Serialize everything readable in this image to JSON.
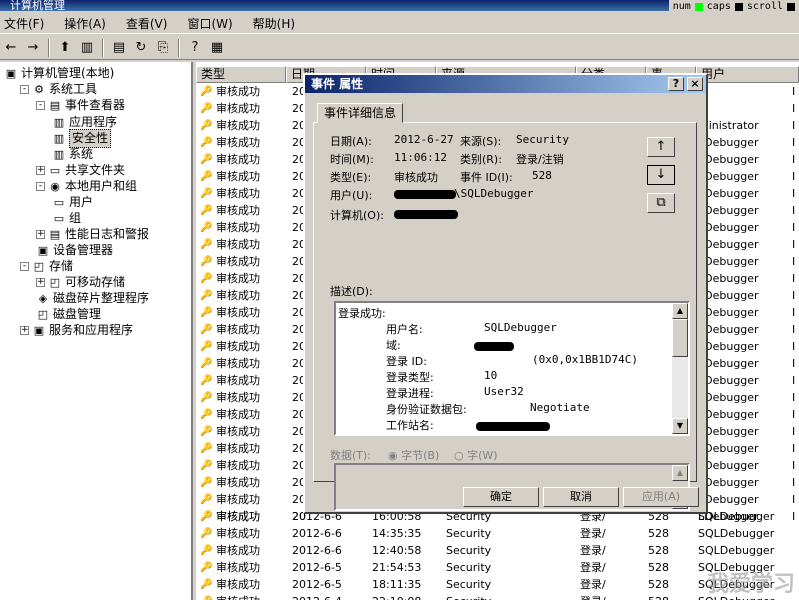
{
  "window_title": "计算机管理",
  "tray": {
    "num": "num",
    "caps": "caps",
    "scroll": "scroll"
  },
  "menu": [
    "文件(F)",
    "操作(A)",
    "查看(V)",
    "窗口(W)",
    "帮助(H)"
  ],
  "tree": [
    {
      "label": "计算机管理(本地)",
      "depth": 0,
      "pm": ""
    },
    {
      "label": "系统工具",
      "depth": 1,
      "pm": "-"
    },
    {
      "label": "事件查看器",
      "depth": 2,
      "pm": "-"
    },
    {
      "label": "应用程序",
      "depth": 3,
      "pm": ""
    },
    {
      "label": "安全性",
      "depth": 3,
      "pm": "",
      "selected": true
    },
    {
      "label": "系统",
      "depth": 3,
      "pm": ""
    },
    {
      "label": "共享文件夹",
      "depth": 2,
      "pm": "+"
    },
    {
      "label": "本地用户和组",
      "depth": 2,
      "pm": "-"
    },
    {
      "label": "用户",
      "depth": 3,
      "pm": ""
    },
    {
      "label": "组",
      "depth": 3,
      "pm": ""
    },
    {
      "label": "性能日志和警报",
      "depth": 2,
      "pm": "+"
    },
    {
      "label": "设备管理器",
      "depth": 2,
      "pm": ""
    },
    {
      "label": "存储",
      "depth": 1,
      "pm": "-"
    },
    {
      "label": "可移动存储",
      "depth": 2,
      "pm": "+"
    },
    {
      "label": "磁盘碎片整理程序",
      "depth": 2,
      "pm": ""
    },
    {
      "label": "磁盘管理",
      "depth": 2,
      "pm": ""
    },
    {
      "label": "服务和应用程序",
      "depth": 1,
      "pm": "+"
    }
  ],
  "columns": [
    "类型",
    "日期",
    "时间",
    "来源",
    "分类",
    "事",
    "用户"
  ],
  "type_label": "审核成功",
  "rows_top": [
    {
      "d": "20",
      "u": "A",
      "x": "I"
    },
    {
      "d": "20",
      "u": "A",
      "x": "I"
    },
    {
      "d": "20",
      "u": "ministrator",
      "x": "I"
    },
    {
      "d": "20",
      "u": "LDebugger",
      "x": "I"
    },
    {
      "d": "20",
      "u": "LDebugger",
      "x": "I"
    },
    {
      "d": "20",
      "u": "LDebugger",
      "x": "I"
    },
    {
      "d": "20",
      "u": "LDebugger",
      "x": "I"
    },
    {
      "d": "20",
      "u": "LDebugger",
      "x": "I"
    },
    {
      "d": "20",
      "u": "LDebugger",
      "x": "I"
    },
    {
      "d": "20",
      "u": "LDebugger",
      "x": "I"
    },
    {
      "d": "20",
      "u": "LDebugger",
      "x": "I"
    },
    {
      "d": "20",
      "u": "LDebugger",
      "x": "I"
    },
    {
      "d": "20",
      "u": "LDebugger",
      "x": "I"
    },
    {
      "d": "20",
      "u": "LDebugger",
      "x": "I"
    },
    {
      "d": "20",
      "u": "LDebugger",
      "x": "I"
    },
    {
      "d": "20",
      "u": "LDebugger",
      "x": "I"
    },
    {
      "d": "20",
      "u": "LDebugger",
      "x": "I"
    },
    {
      "d": "20",
      "u": "LDebugger",
      "x": "I"
    },
    {
      "d": "20",
      "u": "LDebugger",
      "x": "I"
    },
    {
      "d": "20",
      "u": "LDebugger",
      "x": "I"
    },
    {
      "d": "20",
      "u": "LDebugger",
      "x": "I"
    },
    {
      "d": "20",
      "u": "LDebugger",
      "x": "I"
    },
    {
      "d": "20",
      "u": "LDebugger",
      "x": "I"
    },
    {
      "d": "20",
      "u": "LDebugger",
      "x": "I"
    },
    {
      "d": "20",
      "u": "LDebugger",
      "x": "I"
    },
    {
      "d": "20",
      "u": "LDebugger",
      "x": "I"
    }
  ],
  "rows_bottom": [
    {
      "date": "2012-6-6",
      "time": "16:00:58",
      "src": "Security",
      "cat": "登录/",
      "ev": "528",
      "user": "SQLDebugger"
    },
    {
      "date": "2012-6-6",
      "time": "14:35:35",
      "src": "Security",
      "cat": "登录/",
      "ev": "528",
      "user": "SQLDebugger"
    },
    {
      "date": "2012-6-6",
      "time": "12:40:58",
      "src": "Security",
      "cat": "登录/",
      "ev": "528",
      "user": "SQLDebugger"
    },
    {
      "date": "2012-6-5",
      "time": "21:54:53",
      "src": "Security",
      "cat": "登录/",
      "ev": "528",
      "user": "SQLDebugger"
    },
    {
      "date": "2012-6-5",
      "time": "18:11:35",
      "src": "Security",
      "cat": "登录/",
      "ev": "528",
      "user": "SQLDebugger"
    },
    {
      "date": "2012-6-4",
      "time": "22:10:08",
      "src": "Security",
      "cat": "登录/",
      "ev": "528",
      "user": "SQLDebugger"
    }
  ],
  "dialog": {
    "title": "事件 属性",
    "help": "?",
    "close": "×",
    "tab": "事件详细信息",
    "date_label": "日期(A):",
    "date": "2012-6-27",
    "source_label": "来源(S):",
    "source": "Security",
    "time_label": "时间(M):",
    "time": "11:06:12",
    "category_label": "类别(R):",
    "category": "登录/注销",
    "type_label": "类型(E):",
    "type": "审核成功",
    "eventid_label": "事件 ID(I):",
    "eventid": "528",
    "user_label": "用户(U):",
    "user": "\\SQLDebugger",
    "computer_label": "计算机(O):",
    "desc_label": "描述(D):",
    "desc_title": "登录成功:",
    "desc": [
      {
        "k": "用户名:",
        "v": "SQLDebugger"
      },
      {
        "k": "域:",
        "v": ""
      },
      {
        "k": "登录 ID:",
        "v": "(0x0,0x1BB1D74C)"
      },
      {
        "k": "登录类型:",
        "v": "10"
      },
      {
        "k": "登录进程:",
        "v": "User32"
      },
      {
        "k": "身份验证数据包:",
        "v": "Negotiate"
      },
      {
        "k": "工作站名:",
        "v": ""
      }
    ],
    "data_label": "数据(T):",
    "bytes": "字节(B)",
    "words": "字(W)",
    "ok": "确定",
    "cancel": "取消",
    "apply": "应用(A)"
  },
  "watermark": "我爱学习"
}
